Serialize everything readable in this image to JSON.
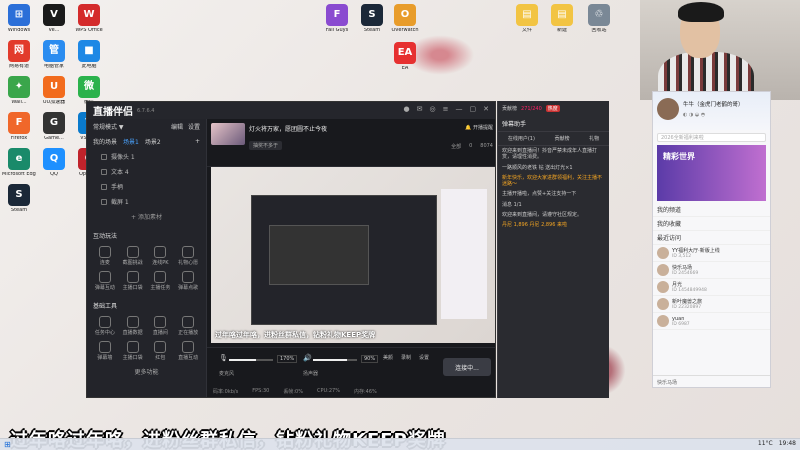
{
  "desktop": {
    "icons_left": [
      {
        "label": "Windows",
        "color": "#2b6fd8",
        "glyph": "⊞"
      },
      {
        "label": "Ve...",
        "color": "#1a1a1a",
        "glyph": "V"
      },
      {
        "label": "WPS Office",
        "color": "#d42b2b",
        "glyph": "W"
      },
      {
        "label": "网易有道",
        "color": "#e23b2c",
        "glyph": "网"
      },
      {
        "label": "电脑管家",
        "color": "#2a8cf0",
        "glyph": "管"
      },
      {
        "label": "此电脑",
        "color": "#1e88e5",
        "glyph": "■"
      },
      {
        "label": "Wall...",
        "color": "#3aa64b",
        "glyph": "✦"
      },
      {
        "label": "UU加速器",
        "color": "#f26b1d",
        "glyph": "U"
      },
      {
        "label": "微信",
        "color": "#2bb24c",
        "glyph": "微"
      },
      {
        "label": "Firefox",
        "color": "#f0672a",
        "glyph": "F"
      },
      {
        "label": "Game...",
        "color": "#333",
        "glyph": "G"
      },
      {
        "label": "VSCo...",
        "color": "#0a7acc",
        "glyph": "V"
      },
      {
        "label": "Microsoft Edge",
        "color": "#1a8a6a",
        "glyph": "e"
      },
      {
        "label": "QQ",
        "color": "#1e90ff",
        "glyph": "Q"
      },
      {
        "label": "Opera...",
        "color": "#c0232b",
        "glyph": "O"
      },
      {
        "label": "Steam",
        "color": "#1b2838",
        "glyph": "S"
      }
    ],
    "icons_top": [
      {
        "label": "Fall Guys",
        "color": "#8a4bd0",
        "glyph": "F"
      },
      {
        "label": "Steam",
        "color": "#1b2838",
        "glyph": "S"
      },
      {
        "label": "Overwatch",
        "color": "#e89c2a",
        "glyph": "O"
      },
      {
        "label": "EA",
        "color": "#e63030",
        "glyph": "EA"
      },
      {
        "label": "文件",
        "color": "#f2c443",
        "glyph": "▤"
      },
      {
        "label": "新建",
        "color": "#f2c443",
        "glyph": "▤"
      },
      {
        "label": "回收站",
        "color": "#7a8896",
        "glyph": "♲"
      }
    ]
  },
  "app": {
    "logo": "直播伴侣",
    "version": "6.7.6.4",
    "stream_title": "灯火将万家，愿团圆不止今夜",
    "stream_subtitle": "抽奖不多于",
    "sidebar": {
      "mode_label": "常规模式 ▼",
      "tab_edit": "编辑",
      "tab_more": "设置",
      "scenes_label": "我的场景",
      "scene_tabs": [
        "场景1",
        "场景2"
      ],
      "sources": [
        {
          "label": "摄像头 1"
        },
        {
          "label": "文本 4"
        },
        {
          "label": "手柄"
        },
        {
          "label": "截屏 1"
        }
      ],
      "add_source": "+ 添加素材",
      "interact_label": "互动玩法",
      "interact_tools": [
        "连麦",
        "截图挑战",
        "连线PK",
        "礼物心愿",
        "弹幕互动",
        "主播口袋",
        "主播任务",
        "弹幕点歌"
      ],
      "base_label": "基础工具",
      "base_tools": [
        "任务中心",
        "直播数据",
        "直播间",
        "正在播放",
        "弹幕墙",
        "主播口袋",
        "红包",
        "直播互动"
      ],
      "more_label": "更多功能"
    },
    "top_actions": {
      "live_notice": "开播提醒",
      "stats": [
        "全部",
        "0",
        "8074"
      ]
    },
    "preview_danmaku": "过年咯过年咯，进粉丝群私信，钻粉礼物KEEP奖牌",
    "controls": {
      "mic_label": "麦克风",
      "mic_value": "170%",
      "speaker_label": "扬声器",
      "speaker_value": "90%",
      "mic_level": 0.62,
      "speaker_level": 0.78,
      "buttons": [
        "美颜",
        "录制",
        "设置"
      ],
      "live_button": "连接中..."
    },
    "status": [
      "码率:0kb/s",
      "FPS:30",
      "丢帧:0%",
      "CPU:27%",
      "内存:46%"
    ],
    "rightpanel": {
      "rank_label": "贡献榜",
      "rank_value": "271/240",
      "hot_label": "热度",
      "tab_labels": [
        "在线用户(1)",
        "贡献榜",
        "礼物"
      ]
    }
  },
  "chat": {
    "header": "弹幕助手",
    "tabs": [
      "在线用户(1)",
      "贡献榜",
      "礼物"
    ],
    "messages": [
      {
        "text": "欢迎来到直播间！抖音严禁未成年人直播打赏，请理性消费。",
        "hl": false
      },
      {
        "text": "一路顺风的老铁 钻 送出灯光×1",
        "hl": false
      },
      {
        "text": "新年快乐，欢迎大家进群领福利，关注主播不迷路～",
        "hl": true
      },
      {
        "text": "主播开播啦，点赞+关注支持一下",
        "hl": false
      },
      {
        "text": "消息 1/1",
        "hl": false
      },
      {
        "text": "欢迎来到直播间，请遵守社区规定。",
        "hl": false
      },
      {
        "text": "丹尼 1,896 丹尼 2,896 来啦",
        "hl": true
      }
    ]
  },
  "messenger": {
    "name": "牛牛（金虎门老鹤的哥）",
    "search_placeholder": "2026全新福利来啦",
    "banner": "精彩世界",
    "menu": [
      "我的频道",
      "我的收藏",
      "最近访问"
    ],
    "contacts": [
      {
        "name": "YY福利大厅·新版上线",
        "sub": "ID 3,512"
      },
      {
        "name": "快乐马场",
        "sub": "ID 2454669"
      },
      {
        "name": "月光",
        "sub": "ID 1454849948"
      },
      {
        "name": "新叶魔兽之旅",
        "sub": "ID 22320897"
      },
      {
        "name": "yuan",
        "sub": "ID 6987"
      }
    ],
    "footer": "快乐马场"
  },
  "subtitle": "过年咯过年咯，进粉丝群私信，钻粉礼物KEEP奖牌",
  "taskbar": {
    "weather": "11°C",
    "time": "19:48"
  }
}
